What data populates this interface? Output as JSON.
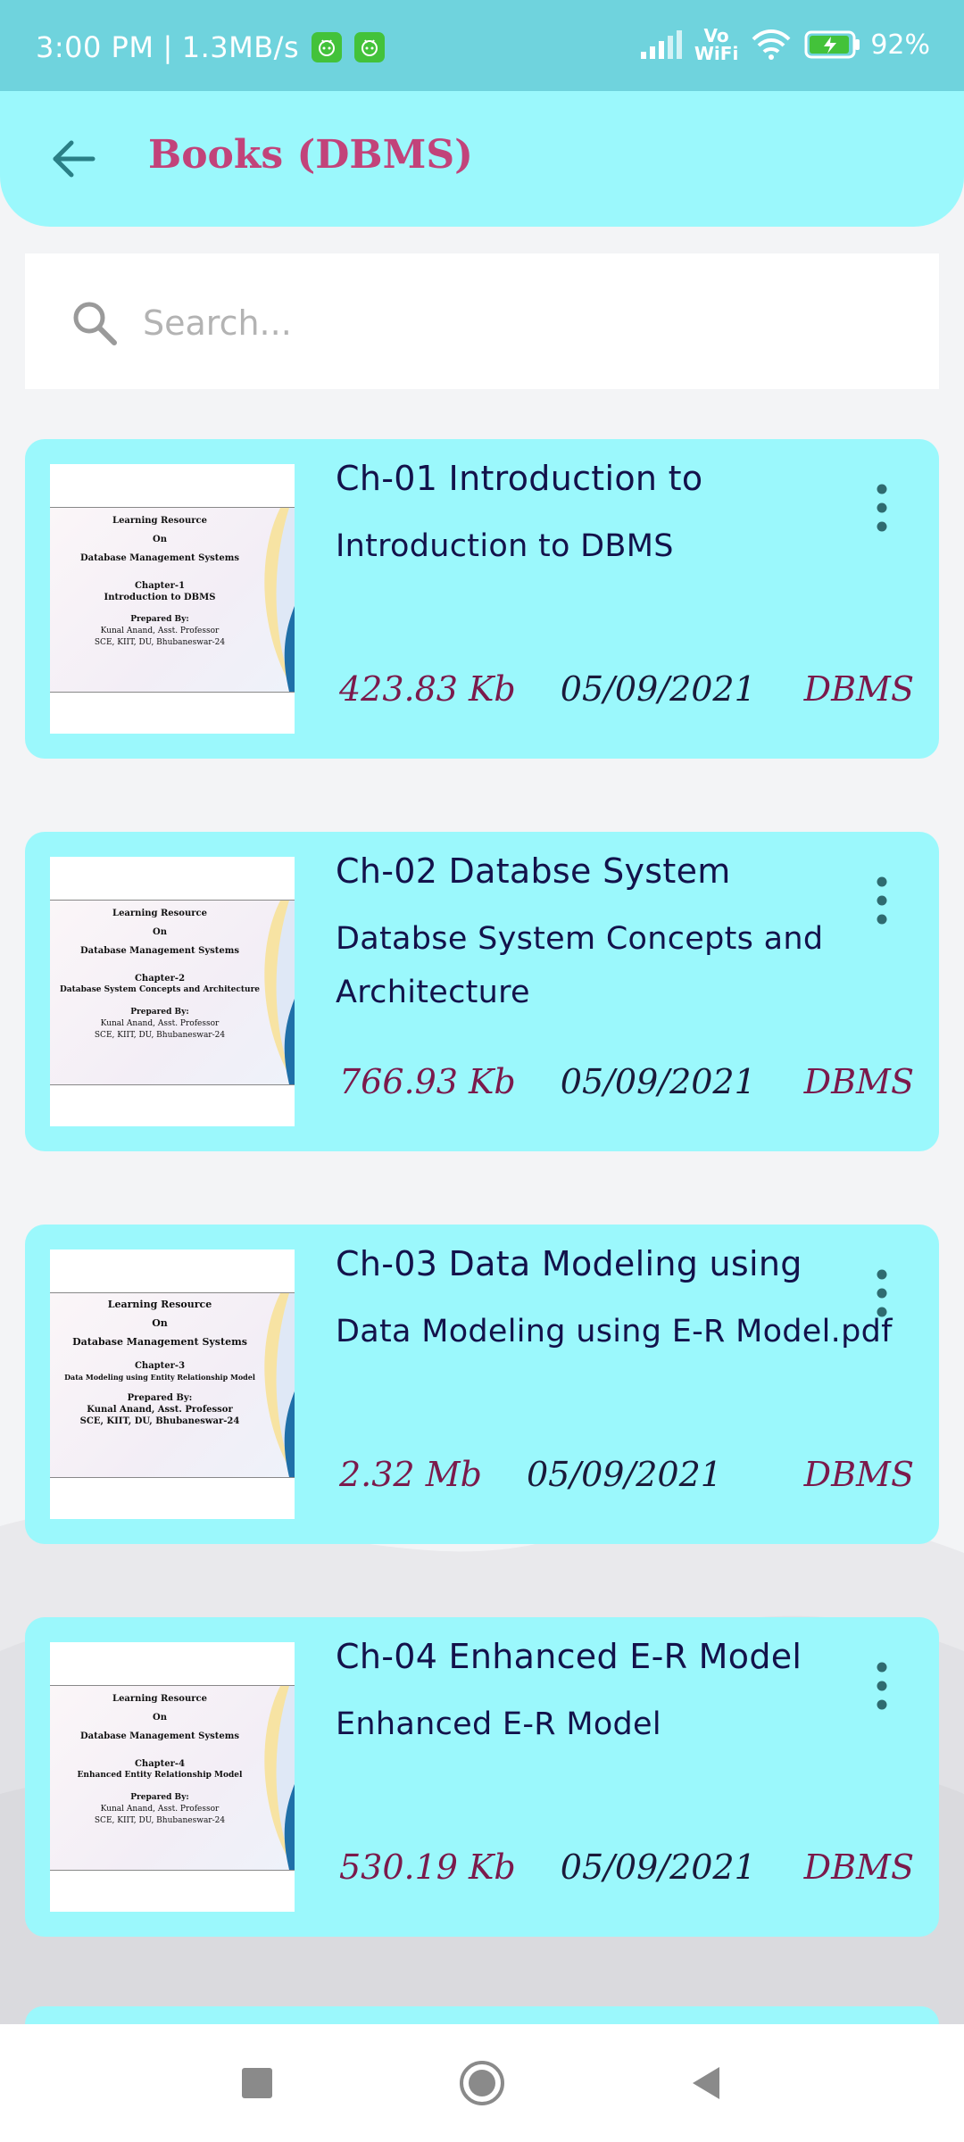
{
  "status_bar": {
    "time": "3:00 PM",
    "separator": "|",
    "speed": "1.3MB/s",
    "vowifi_top": "Vo",
    "vowifi_bottom": "WiFi",
    "battery": "92%"
  },
  "header": {
    "title": "Books (DBMS)"
  },
  "search": {
    "placeholder": "Search..."
  },
  "books": [
    {
      "title": "Ch-01 Introduction to",
      "subtitle": "Introduction to DBMS",
      "size": "423.83 Kb",
      "date": "05/09/2021",
      "tag": "DBMS",
      "thumb": {
        "l1": "Learning Resource",
        "l2": "On",
        "l3": "Database Management Systems",
        "l4": "Chapter-1",
        "l5": "Introduction to DBMS",
        "l6": "Prepared By:",
        "l7": "Kunal Anand, Asst. Professor",
        "l8": "SCE, KIIT, DU, Bhubaneswar-24"
      }
    },
    {
      "title": "Ch-02 Databse System",
      "subtitle": "Databse System Concepts and Architecture",
      "size": "766.93 Kb",
      "date": "05/09/2021",
      "tag": "DBMS",
      "thumb": {
        "l1": "Learning Resource",
        "l2": "On",
        "l3": "Database Management Systems",
        "l4": "Chapter-2",
        "l5": "Database System Concepts and Architecture",
        "l6": "Prepared By:",
        "l7": "Kunal Anand, Asst. Professor",
        "l8": "SCE, KIIT, DU, Bhubaneswar-24"
      }
    },
    {
      "title": "Ch-03 Data Modeling using",
      "subtitle": "Data Modeling using E-R Model.pdf",
      "size": "2.32 Mb",
      "date": "05/09/2021",
      "tag": "DBMS",
      "thumb": {
        "l1": "Learning Resource",
        "l2": "On",
        "l3": "Database Management Systems",
        "l4": "Chapter-3",
        "l5": "Data Modeling using Entity Relationship Model",
        "l6": "Prepared By:",
        "l7": "Kunal Anand, Asst. Professor",
        "l8": "SCE, KIIT, DU, Bhubaneswar-24"
      }
    },
    {
      "title": "Ch-04 Enhanced E-R Model",
      "subtitle": "Enhanced E-R Model",
      "size": "530.19 Kb",
      "date": "05/09/2021",
      "tag": "DBMS",
      "thumb": {
        "l1": "Learning Resource",
        "l2": "On",
        "l3": "Database Management Systems",
        "l4": "Chapter-4",
        "l5": "Enhanced Entity Relationship Model",
        "l6": "Prepared By:",
        "l7": "Kunal Anand, Asst. Professor",
        "l8": "SCE, KIIT, DU, Bhubaneswar-24"
      }
    }
  ],
  "icons": {
    "back": "arrow-left-icon",
    "search": "search-icon",
    "menu": "more-vertical-icon",
    "nav_recents": "square-icon",
    "nav_home": "circle-icon",
    "nav_back": "triangle-back-icon"
  },
  "colors": {
    "status_bar": "#6fd3dd",
    "header": "#9bf8fc",
    "card": "#9bf8fc",
    "title_accent": "#c2437a",
    "meta_text": "#7b1a4c",
    "card_text": "#13124b"
  }
}
